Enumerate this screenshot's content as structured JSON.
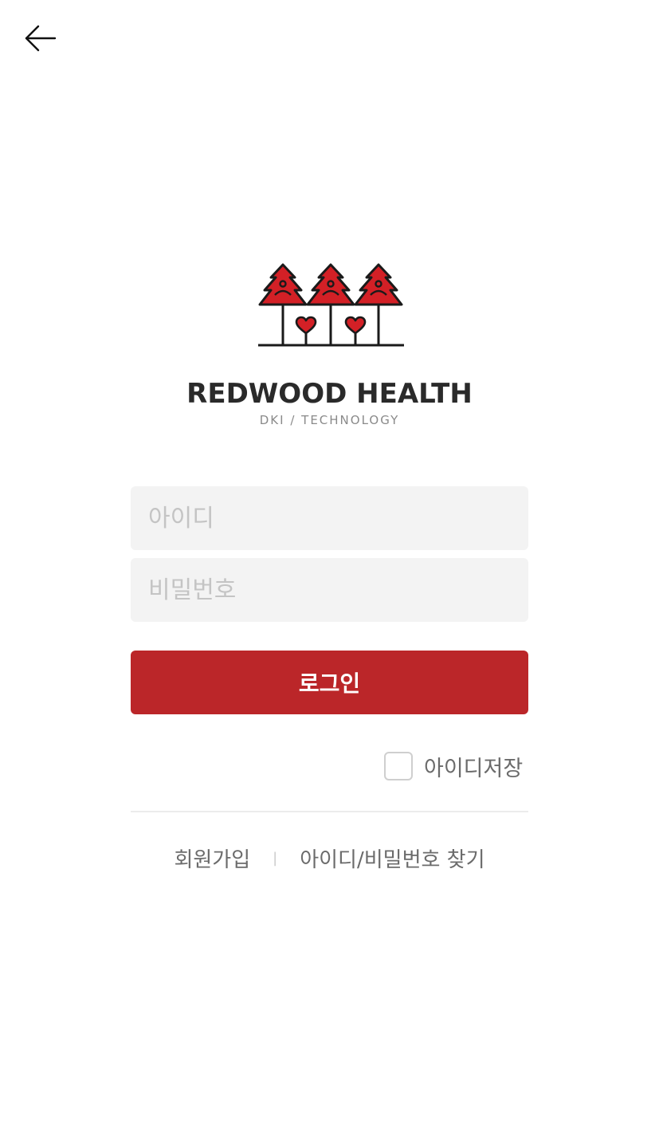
{
  "header": {
    "back_icon": "arrow-left-icon"
  },
  "logo": {
    "brand_name": "REDWOOD HEALTH",
    "tagline": "DKI / TECHNOLOGY",
    "icon": "redwood-trees-hearts-logo",
    "colors": {
      "tree": "#d32026",
      "outline": "#1a1a1a"
    }
  },
  "form": {
    "id_placeholder": "아이디",
    "id_value": "",
    "password_placeholder": "비밀번호",
    "password_value": "",
    "login_label": "로그인",
    "remember_label": "아이디저장",
    "remember_checked": false
  },
  "links": {
    "signup": "회원가입",
    "separator": "|",
    "find_account": "아이디/비밀번호 찾기"
  },
  "colors": {
    "accent": "#bb2629",
    "field_bg": "#f3f3f3",
    "text_muted": "#6b6b6b"
  }
}
